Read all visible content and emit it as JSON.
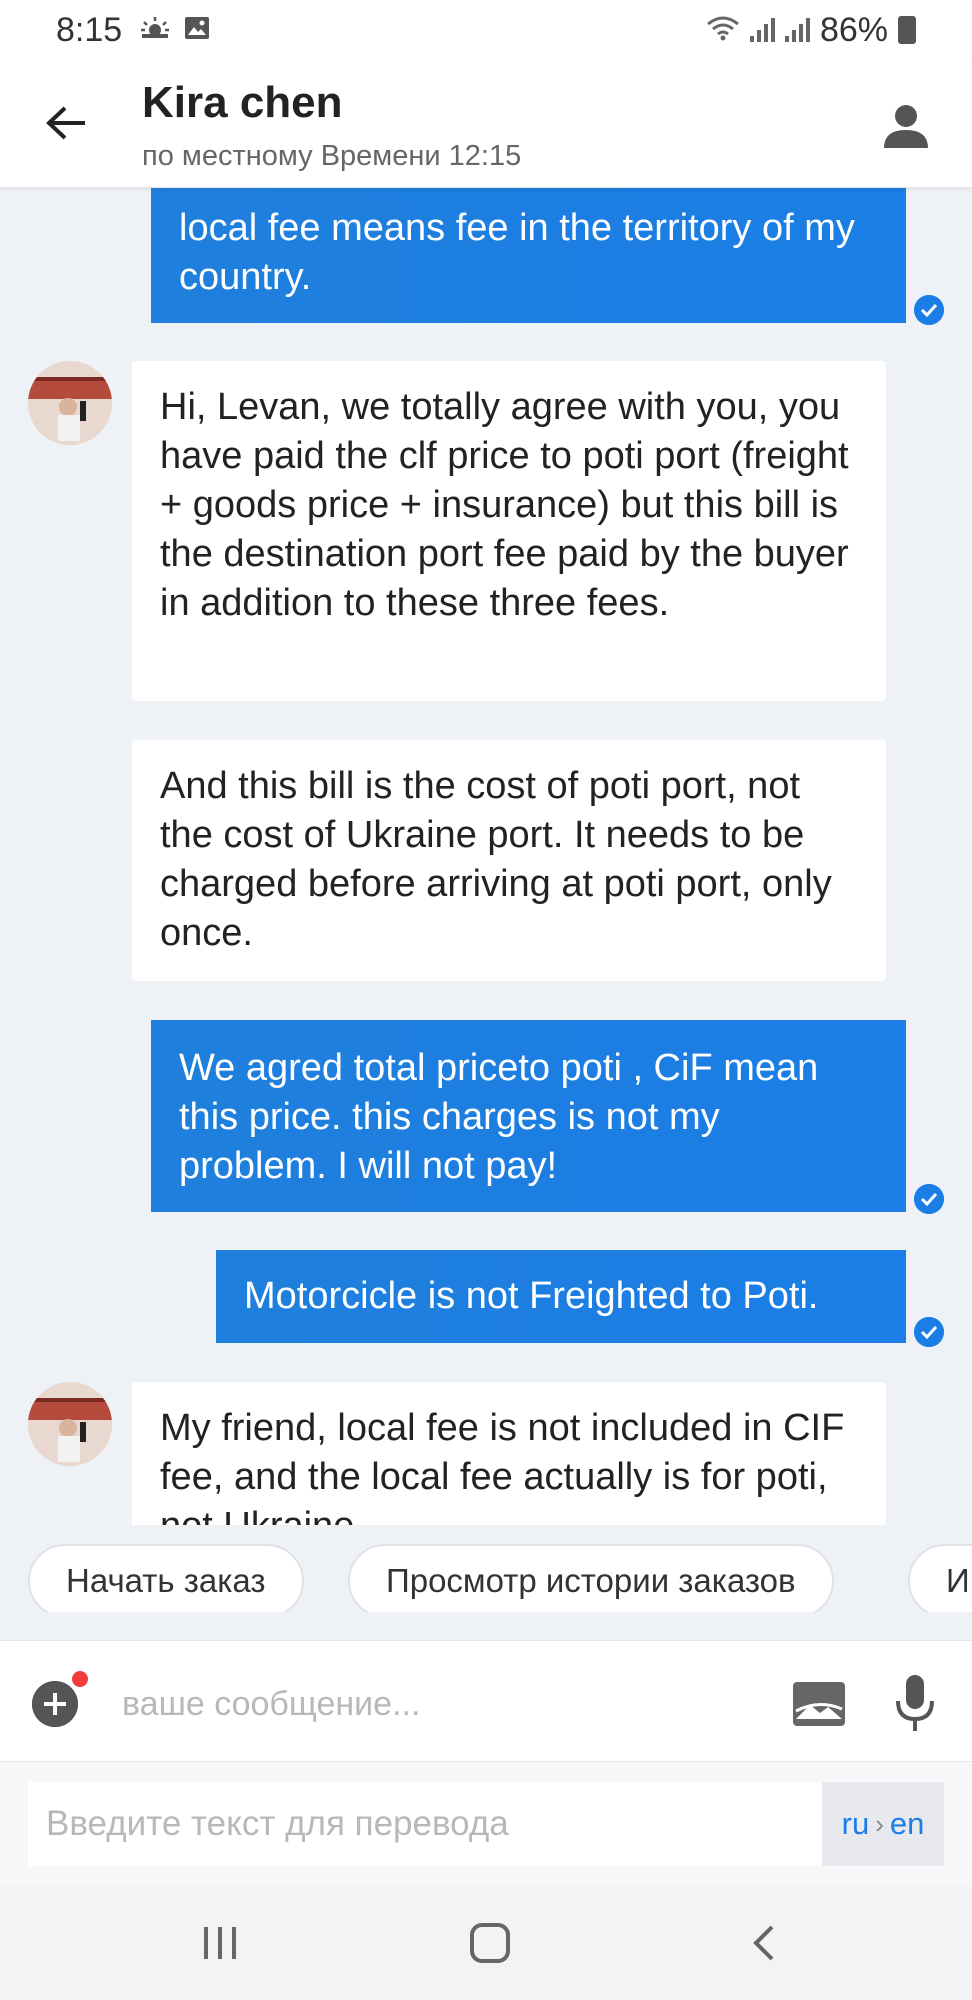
{
  "status_bar": {
    "time": "8:15",
    "battery": "86%"
  },
  "header": {
    "name": "Kira chen",
    "subtitle": "по местному Времени 12:15"
  },
  "messages": [
    {
      "dir": "out",
      "text": "local fee means fee in the territory of my country."
    },
    {
      "dir": "in",
      "text": "Hi, Levan, we totally agree with you, you have paid the clf price to poti port (freight + goods price + insurance) but this bill is the destination port fee paid by the buyer in addition to these three fees."
    },
    {
      "dir": "in",
      "text": "And this bill is the cost of poti port, not the cost of Ukraine port. It needs to be charged before arriving at poti port, only once."
    },
    {
      "dir": "out",
      "text": "We agred total priceto poti , CiF mean this price. this charges is not my problem. I will not pay!"
    },
    {
      "dir": "out",
      "text": "Motorcicle is not Freighted to Poti."
    },
    {
      "dir": "in",
      "text": "My friend, local fee is not included in CIF fee, and the local fee actually is for poti, not Ukraine"
    }
  ],
  "quick_replies": [
    "Начать заказ",
    "Просмотр истории заказов",
    "И"
  ],
  "input": {
    "placeholder": "ваше сообщение..."
  },
  "translate": {
    "placeholder": "Введите текст для перевода",
    "from": "ru",
    "to": "en",
    "separator": "›"
  },
  "colors": {
    "accent": "#1a7ee6",
    "background": "#eef1f6",
    "notification_dot": "#f03c3c"
  }
}
